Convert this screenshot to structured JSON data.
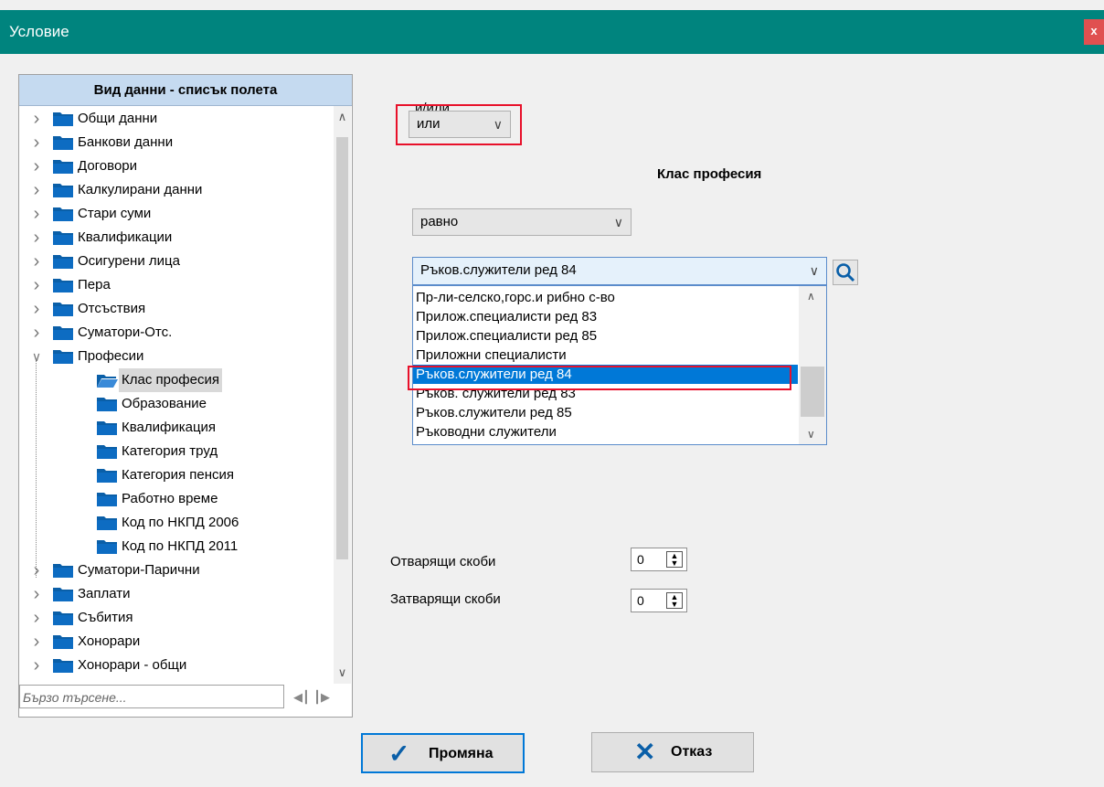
{
  "window": {
    "title": "Условие",
    "close_label": "x"
  },
  "tree": {
    "header": "Вид данни - списък полета",
    "items": [
      {
        "label": "Общи данни",
        "level": 0,
        "expanded": false
      },
      {
        "label": "Банкови данни",
        "level": 0,
        "expanded": false
      },
      {
        "label": "Договори",
        "level": 0,
        "expanded": false
      },
      {
        "label": "Калкулирани данни",
        "level": 0,
        "expanded": false
      },
      {
        "label": "Стари суми",
        "level": 0,
        "expanded": false
      },
      {
        "label": "Квалификации",
        "level": 0,
        "expanded": false
      },
      {
        "label": "Осигурени лица",
        "level": 0,
        "expanded": false
      },
      {
        "label": "Пера",
        "level": 0,
        "expanded": false
      },
      {
        "label": "Отсъствия",
        "level": 0,
        "expanded": false
      },
      {
        "label": "Суматори-Отс.",
        "level": 0,
        "expanded": false
      },
      {
        "label": "Професии",
        "level": 0,
        "expanded": true
      },
      {
        "label": "Клас професия",
        "level": 1,
        "selected": true
      },
      {
        "label": "Образование",
        "level": 1
      },
      {
        "label": "Квалификация",
        "level": 1
      },
      {
        "label": "Категория труд",
        "level": 1
      },
      {
        "label": "Категория пенсия",
        "level": 1
      },
      {
        "label": "Работно време",
        "level": 1
      },
      {
        "label": "Код по НКПД 2006",
        "level": 1
      },
      {
        "label": "Код по НКПД 2011",
        "level": 1
      },
      {
        "label": "Суматори-Парични",
        "level": 0,
        "expanded": false
      },
      {
        "label": "Заплати",
        "level": 0,
        "expanded": false
      },
      {
        "label": "Събития",
        "level": 0,
        "expanded": false
      },
      {
        "label": "Хонорари",
        "level": 0,
        "expanded": false
      },
      {
        "label": "Хонорари - общи",
        "level": 0,
        "expanded": false
      }
    ],
    "search_placeholder": "Бързо търсене..."
  },
  "condition": {
    "andor_label": "и/или",
    "andor_value": "или",
    "field_title": "Клас професия",
    "operator_value": "равно",
    "value_selected": "Ръков.служители ред 84",
    "options": [
      "Пр-ли-селско,горс.и рибно с-во",
      "Прилож.специалисти ред 83",
      "Прилож.специалисти ред 85",
      "Приложни специалисти",
      "Ръков.служители ред 84",
      "Ръков. служители ред 83",
      "Ръков.служители ред 85",
      "Ръководни служители"
    ],
    "selected_index": 4
  },
  "brackets": {
    "open_label": "Отварящи скоби",
    "open_value": "0",
    "close_label": "Затварящи скоби",
    "close_value": "0"
  },
  "buttons": {
    "ok_label": "Промяна",
    "cancel_label": "Отказ"
  },
  "colors": {
    "titlebar": "#00847e",
    "accent": "#0078d7",
    "highlight": "#e8102a",
    "folder": "#0a5fa8"
  }
}
